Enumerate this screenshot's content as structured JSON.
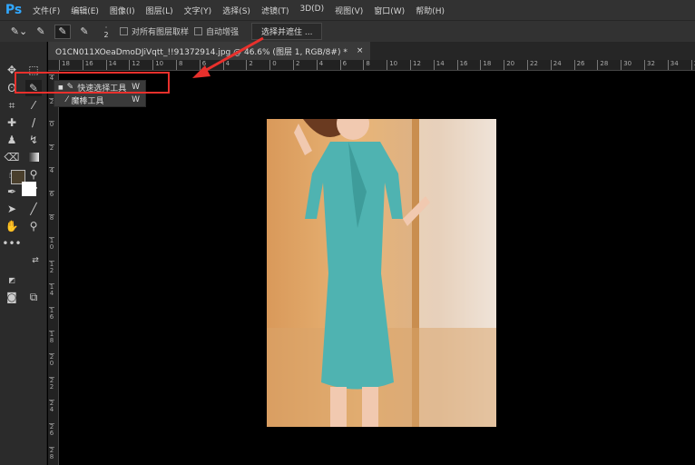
{
  "app": {
    "logo": "Ps"
  },
  "menu": [
    "文件(F)",
    "编辑(E)",
    "图像(I)",
    "图层(L)",
    "文字(Y)",
    "选择(S)",
    "滤镜(T)",
    "3D(D)",
    "视图(V)",
    "窗口(W)",
    "帮助(H)"
  ],
  "options": {
    "brush_size": "2",
    "sample_all_layers": "对所有图层取样",
    "auto_enhance": "自动增强",
    "select_and_mask": "选择并遮住 ..."
  },
  "document_tab": {
    "title": "O1CN011XOeaDmoDJiVqtt_!!91372914.jpg @ 46.6% (图层 1, RGB/8#) *",
    "close": "×"
  },
  "flyout": {
    "items": [
      {
        "label": "快速选择工具",
        "shortcut": "W",
        "selected": true
      },
      {
        "label": "魔棒工具",
        "shortcut": "W",
        "selected": false
      }
    ]
  },
  "ruler": {
    "h": [
      "18",
      "16",
      "14",
      "12",
      "10",
      "8",
      "6",
      "4",
      "2",
      "0",
      "2",
      "4",
      "6",
      "8",
      "10",
      "12",
      "14",
      "16",
      "18",
      "20",
      "22",
      "24",
      "26",
      "28",
      "30",
      "32",
      "34",
      "36"
    ],
    "v": [
      "4",
      "2",
      "0",
      "2",
      "4",
      "6",
      "8",
      "10",
      "12",
      "14",
      "16",
      "18",
      "20",
      "22",
      "24",
      "26",
      "28"
    ]
  },
  "colors": {
    "foreground": "#4a3f2c",
    "background": "#ffffff",
    "highlight": "#e8302c",
    "dress": "#4fb3b1"
  }
}
